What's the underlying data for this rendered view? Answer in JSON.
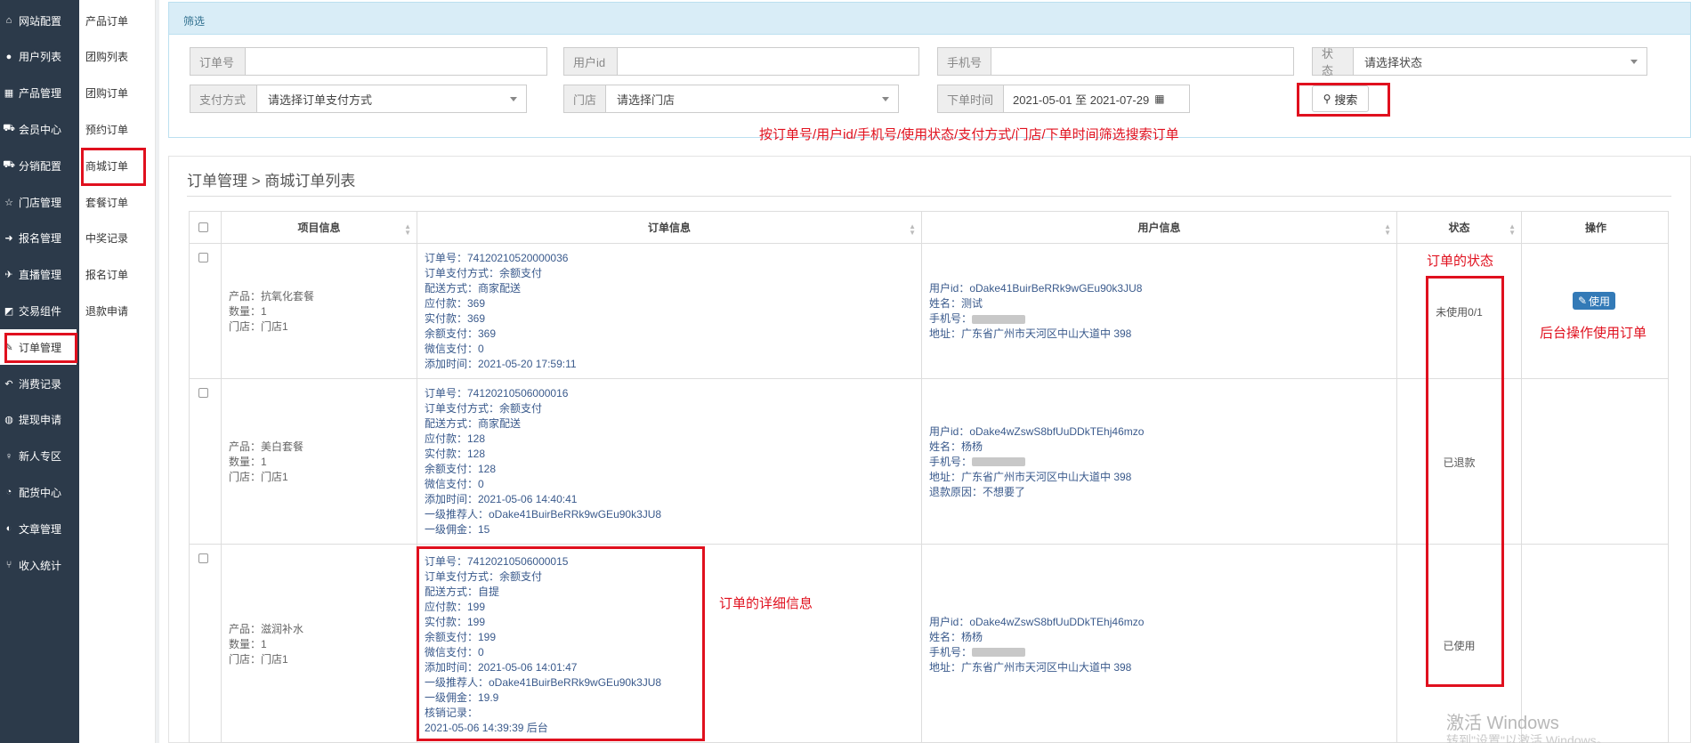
{
  "sidebar": {
    "items": [
      {
        "icon": "home-icon",
        "glyph": "⌂",
        "label": "网站配置"
      },
      {
        "icon": "user-icon",
        "glyph": "●",
        "label": "用户列表"
      },
      {
        "icon": "product-icon",
        "glyph": "▦",
        "label": "产品管理"
      },
      {
        "icon": "cart-icon",
        "glyph": "⛟",
        "label": "会员中心"
      },
      {
        "icon": "cart-icon",
        "glyph": "⛟",
        "label": "分销配置"
      },
      {
        "icon": "star-icon",
        "glyph": "☆",
        "label": "门店管理"
      },
      {
        "icon": "signin-icon",
        "glyph": "➜",
        "label": "报名管理"
      },
      {
        "icon": "plane-icon",
        "glyph": "✈",
        "label": "直播管理"
      },
      {
        "icon": "eraser-icon",
        "glyph": "◩",
        "label": "交易组件"
      },
      {
        "icon": "edit-icon",
        "glyph": "✎",
        "label": "订单管理"
      },
      {
        "icon": "reply-icon",
        "glyph": "↶",
        "label": "消费记录"
      },
      {
        "icon": "wechat-icon",
        "glyph": "◍",
        "label": "提现申请"
      },
      {
        "icon": "pin-icon",
        "glyph": "♀",
        "label": "新人专区"
      },
      {
        "icon": "pie-icon",
        "glyph": "◔",
        "label": "配货中心"
      },
      {
        "icon": "contrast-icon",
        "glyph": "◐",
        "label": "文章管理"
      },
      {
        "icon": "branch-icon",
        "glyph": "⑂",
        "label": "收入统计"
      }
    ]
  },
  "submenu": {
    "items": [
      "产品订单",
      "团购列表",
      "团购订单",
      "预约订单",
      "商城订单",
      "套餐订单",
      "中奖记录",
      "报名订单",
      "退款申请"
    ]
  },
  "filter": {
    "title": "筛选",
    "order_no_label": "订单号",
    "user_id_label": "用户id",
    "phone_label": "手机号",
    "status_label": "状态",
    "status_value": "请选择状态",
    "pay_label": "支付方式",
    "pay_value": "请选择订单支付方式",
    "store_label": "门店",
    "store_value": "请选择门店",
    "time_label": "下单时间",
    "time_value": "2021-05-01 至 2021-07-29",
    "search_label": "搜索"
  },
  "annotations": {
    "filter_note": "按订单号/用户id/手机号/使用状态/支付方式/门店/下单时间筛选搜索订单",
    "status_note": "订单的状态",
    "action_note": "后台操作使用订单",
    "detail_note": "订单的详细信息"
  },
  "breadcrumb": "订单管理 > 商城订单列表",
  "table": {
    "headers": [
      "项目信息",
      "订单信息",
      "用户信息",
      "状态",
      "操作"
    ],
    "action_label": "使用",
    "rows": [
      {
        "project": [
          "产品：抗氧化套餐",
          "数量：1",
          "门店：门店1"
        ],
        "order": [
          "订单号：74120210520000036",
          "订单支付方式：余额支付",
          "配送方式：商家配送",
          "应付款：369",
          "实付款：369",
          "余额支付：369",
          "微信支付：0",
          "添加时间：2021-05-20 17:59:11"
        ],
        "user": [
          "用户id：oDake41BuirBeRRk9wGEu90k3JU8",
          "姓名：测试",
          "手机号：",
          "地址：广东省广州市天河区中山大道中 398"
        ],
        "status": "未使用0/1"
      },
      {
        "project": [
          "产品：美白套餐",
          "数量：1",
          "门店：门店1"
        ],
        "order": [
          "订单号：74120210506000016",
          "订单支付方式：余额支付",
          "配送方式：商家配送",
          "应付款：128",
          "实付款：128",
          "余额支付：128",
          "微信支付：0",
          "添加时间：2021-05-06 14:40:41",
          "一级推荐人：oDake41BuirBeRRk9wGEu90k3JU8",
          "一级佣金：15"
        ],
        "user": [
          "用户id：oDake4wZswS8bfUuDDkTEhj46mzo",
          "姓名：杨杨",
          "手机号：",
          "地址：广东省广州市天河区中山大道中 398",
          "退款原因：不想要了"
        ],
        "status": "已退款"
      },
      {
        "project": [
          "产品：滋润补水",
          "数量：1",
          "门店：门店1"
        ],
        "order": [
          "订单号：74120210506000015",
          "订单支付方式：余额支付",
          "配送方式：自提",
          "应付款：199",
          "实付款：199",
          "余额支付：199",
          "微信支付：0",
          "添加时间：2021-05-06 14:01:47",
          "一级推荐人：oDake41BuirBeRRk9wGEu90k3JU8",
          "一级佣金：19.9",
          "核销记录：",
          "2021-05-06 14:39:39 后台"
        ],
        "user": [
          "用户id：oDake4wZswS8bfUuDDkTEhj46mzo",
          "姓名：杨杨",
          "手机号：",
          "地址：广东省广州市天河区中山大道中 398"
        ],
        "status": "已使用"
      }
    ]
  },
  "watermark": "激活 Windows",
  "watermark_sub": "转到\"设置\"以激活 Windows。"
}
